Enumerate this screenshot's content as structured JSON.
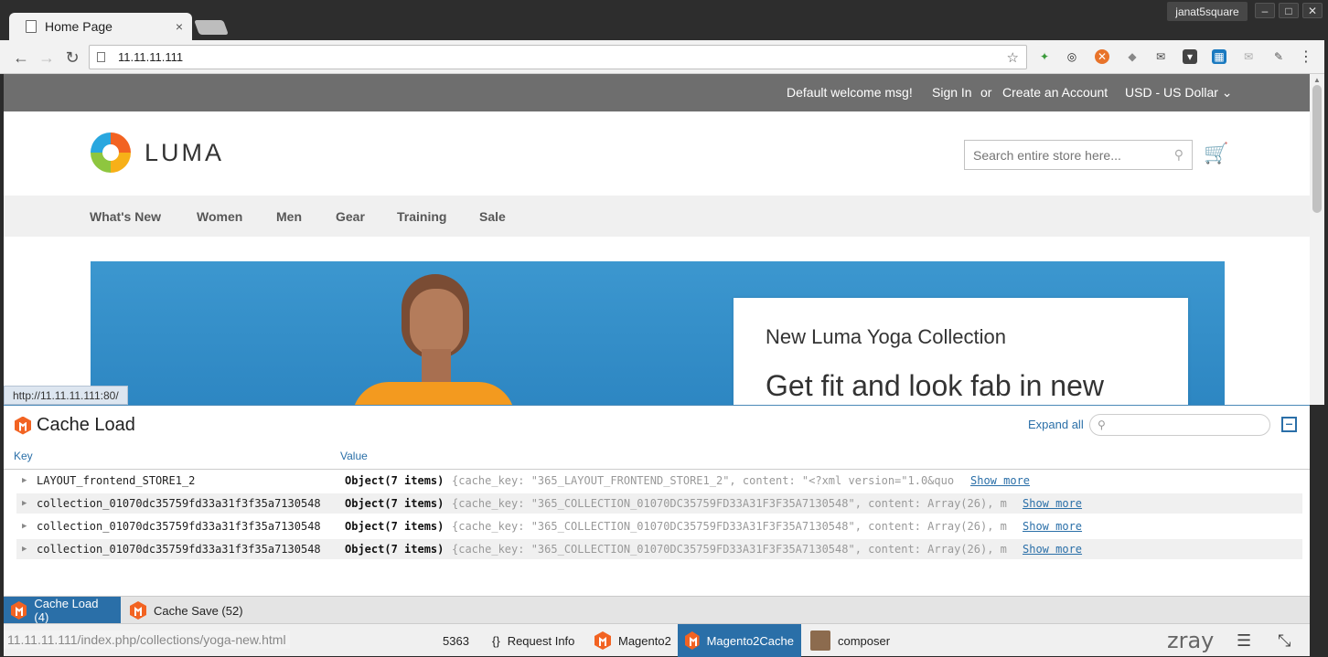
{
  "browser": {
    "tab_title": "Home Page",
    "tab_close": "×",
    "user_label": "janat5square",
    "win_minimize": "–",
    "win_maximize": "□",
    "win_close": "✕",
    "url": "11.11.11.111",
    "star": "☆"
  },
  "page": {
    "panel_header": {
      "welcome": "Default welcome msg!",
      "sign_in": "Sign In",
      "or": "or",
      "create_account": "Create an Account",
      "currency": "USD - US Dollar ⌄"
    },
    "logo_text": "LUMA",
    "search_placeholder": "Search entire store here...",
    "nav": [
      "What's New",
      "Women",
      "Men",
      "Gear",
      "Training",
      "Sale"
    ],
    "hero": {
      "subtitle": "New Luma Yoga Collection",
      "headline": "Get fit and look fab in new"
    },
    "status_link": "http://11.11.11.111:80/"
  },
  "zray": {
    "title": "Cache Load",
    "expand_all": "Expand all",
    "columns": {
      "key": "Key",
      "value": "Value"
    },
    "rows": [
      {
        "key": "LAYOUT_frontend_STORE1_2",
        "obj": "Object(7 items)",
        "preview": "{cache_key: \"365_LAYOUT_FRONTEND_STORE1_2\", content: \"<?xml version=\"1.0&quo",
        "more": "Show more"
      },
      {
        "key": "collection_01070dc35759fd33a31f3f35a7130548",
        "obj": "Object(7 items)",
        "preview": "{cache_key: \"365_COLLECTION_01070DC35759FD33A31F3F35A7130548\", content: Array(26), m",
        "more": "Show more"
      },
      {
        "key": "collection_01070dc35759fd33a31f3f35a7130548",
        "obj": "Object(7 items)",
        "preview": "{cache_key: \"365_COLLECTION_01070DC35759FD33A31F3F35A7130548\", content: Array(26), m",
        "more": "Show more"
      },
      {
        "key": "collection_01070dc35759fd33a31f3f35a7130548",
        "obj": "Object(7 items)",
        "preview": "{cache_key: \"365_COLLECTION_01070DC35759FD33A31F3F35A7130548\", content: Array(26), m",
        "more": "Show more"
      }
    ],
    "tabs": [
      {
        "label": "Cache Load (4)"
      },
      {
        "label": "Cache Save (52)"
      }
    ],
    "bar": {
      "hover_url": "11.11.11.111/index.php/collections/yoga-new.html",
      "partial": "5363",
      "request_info": "Request Info",
      "request_icon": "{}",
      "magento2": "Magento2",
      "magento2cache": "Magento2Cache",
      "composer": "composer",
      "logo": "zray",
      "menu_icon": "☰",
      "collapse_icon": "⤡"
    }
  },
  "colors": {
    "accent": "#2a6fa8",
    "magento_orange": "#f26322",
    "header_gray": "#6e6e6e"
  }
}
